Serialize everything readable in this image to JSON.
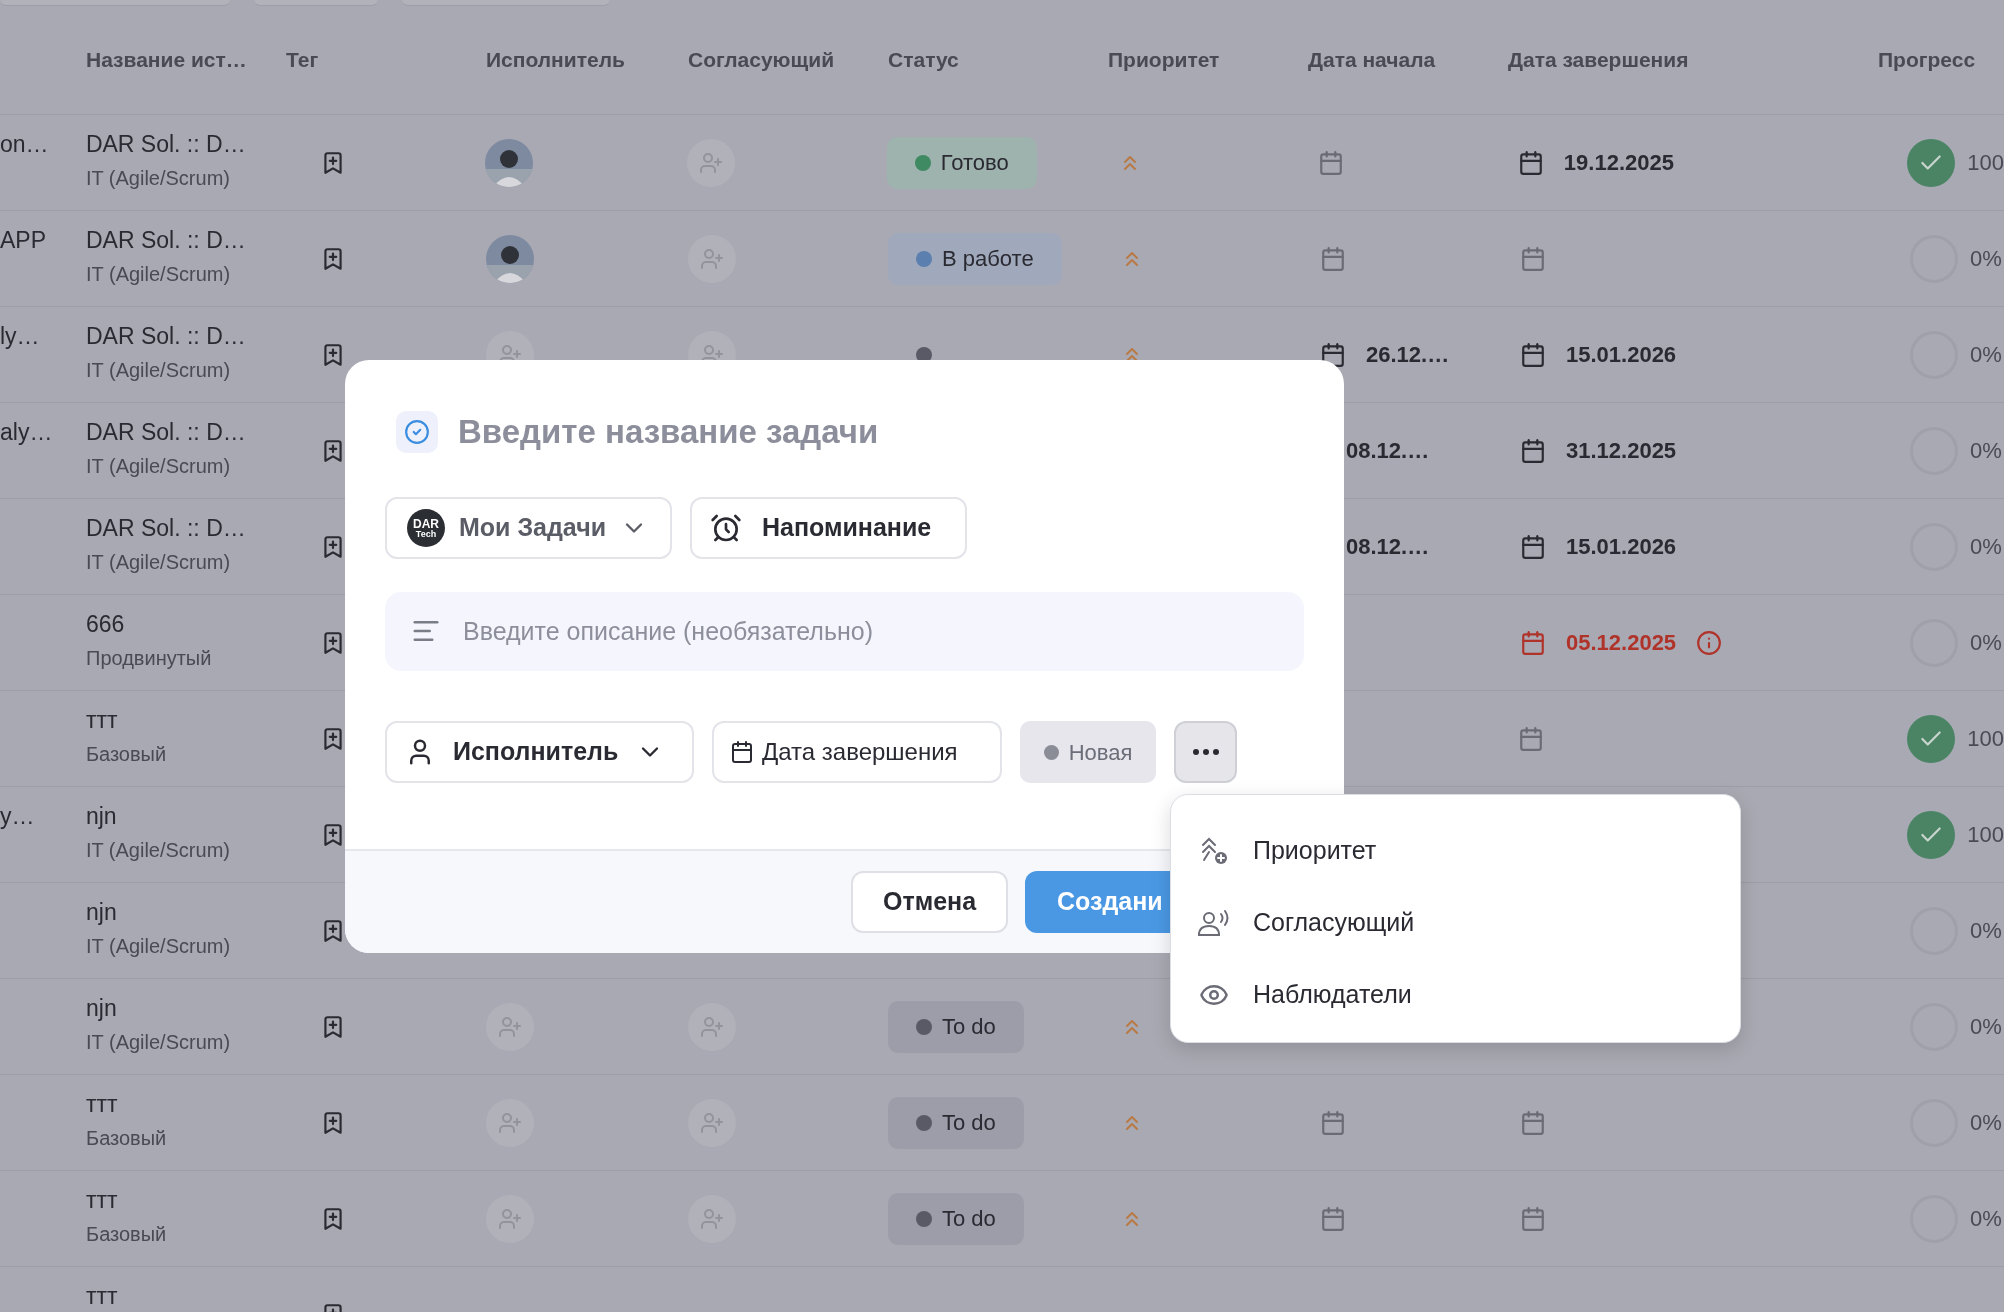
{
  "filter_chips": [
    {
      "kind": "chip"
    },
    {
      "kind": "chip"
    },
    {
      "kind": "chip"
    }
  ],
  "table": {
    "columns": [
      "Название ист…",
      "Тег",
      "Исполнитель",
      "Согласующий",
      "Статус",
      "Приоритет",
      "Дата начала",
      "Дата завершения",
      "Прогресс"
    ],
    "rows": [
      {
        "lead": "on…",
        "title": "DAR Sol. :: D…",
        "subtitle": "IT (Agile/Scrum)",
        "approver": {
          "kind": "empty"
        },
        "status": {
          "label": "Готово",
          "kind": "done",
          "color": "#3f8a63"
        },
        "priority": {
          "kind": "high"
        },
        "start": {
          "kind": "empty"
        },
        "end": {
          "kind": "filled",
          "text": "19.12.2025",
          "overdue": false
        },
        "progress": {
          "complete": true,
          "text": "100"
        }
      },
      {
        "lead": "APP",
        "title": "DAR Sol. :: D…",
        "subtitle": "IT (Agile/Scrum)",
        "approver": {
          "kind": "empty"
        },
        "status": {
          "label": "В работе",
          "kind": "progress",
          "color": "#5b7fae"
        },
        "priority": {
          "kind": "high"
        },
        "start": {
          "kind": "empty"
        },
        "end": {
          "kind": "empty"
        },
        "progress": {
          "complete": false,
          "text": "0%"
        }
      },
      {
        "lead": "ly…",
        "title": "DAR Sol. :: D…",
        "subtitle": "IT (Agile/Scrum)",
        "assignee": {
          "kind": "empty"
        },
        "approver": {
          "kind": "empty"
        },
        "status": {
          "kind": "backlog",
          "color": "#5a5a66"
        },
        "priority": {
          "kind": "high"
        },
        "start": {
          "kind": "filled",
          "text": "26.12.…"
        },
        "end": {
          "kind": "filled",
          "text": "15.01.2026",
          "overdue": false
        },
        "progress": {
          "complete": false,
          "text": "0%"
        }
      },
      {
        "lead": "aly…",
        "title": "DAR Sol. :: D…",
        "subtitle": "IT (Agile/Scrum)",
        "start": {
          "kind": "text",
          "text": "08.12.…"
        },
        "end": {
          "kind": "filled",
          "text": "31.12.2025",
          "overdue": false
        },
        "progress": {
          "complete": false,
          "text": "0%"
        }
      },
      {
        "title": "DAR Sol. :: D…",
        "subtitle": "IT (Agile/Scrum)",
        "start": {
          "kind": "text",
          "text": "08.12.…"
        },
        "end": {
          "kind": "filled",
          "text": "15.01.2026",
          "overdue": false
        },
        "progress": {
          "complete": false,
          "text": "0%"
        }
      },
      {
        "title": "666",
        "subtitle": "Продвинутый",
        "end": {
          "kind": "filled",
          "text": "05.12.2025",
          "overdue": true
        },
        "progress": {
          "complete": false,
          "text": "0%"
        }
      },
      {
        "title": "ттт",
        "subtitle": "Базовый",
        "end": {
          "kind": "empty"
        },
        "progress": {
          "complete": true,
          "text": "100"
        }
      },
      {
        "lead": "y…",
        "title": "njn",
        "subtitle": "IT (Agile/Scrum)",
        "progress": {
          "complete": true,
          "text": "100"
        }
      },
      {
        "title": "njn",
        "subtitle": "IT (Agile/Scrum)",
        "progress": {
          "complete": false,
          "text": "0%"
        }
      },
      {
        "title": "njn",
        "subtitle": "IT (Agile/Scrum)",
        "assignee": {
          "kind": "empty"
        },
        "approver": {
          "kind": "empty"
        },
        "status": {
          "label": "To do",
          "kind": "todo",
          "color": "#5a5a66"
        },
        "priority": {
          "kind": "high"
        },
        "progress": {
          "complete": false,
          "text": "0%"
        }
      },
      {
        "title": "ттт",
        "subtitle": "Базовый",
        "assignee": {
          "kind": "empty"
        },
        "approver": {
          "kind": "empty"
        },
        "status": {
          "label": "To do",
          "kind": "todo",
          "color": "#5a5a66"
        },
        "priority": {
          "kind": "high"
        },
        "start": {
          "kind": "empty"
        },
        "end": {
          "kind": "empty"
        },
        "progress": {
          "complete": false,
          "text": "0%"
        }
      },
      {
        "title": "ттт",
        "subtitle": "Базовый",
        "assignee": {
          "kind": "empty"
        },
        "approver": {
          "kind": "empty"
        },
        "status": {
          "label": "To do",
          "kind": "todo",
          "color": "#5a5a66"
        },
        "priority": {
          "kind": "high"
        },
        "start": {
          "kind": "empty"
        },
        "end": {
          "kind": "empty"
        },
        "progress": {
          "complete": false,
          "text": "0%"
        }
      },
      {
        "title": "ттт"
      }
    ]
  },
  "modal": {
    "title_placeholder": "Введите название задачи",
    "project": {
      "label": "Мои Задачи",
      "logo": "DAR",
      "logo_sub": "Tech"
    },
    "reminder": "Напоминание",
    "description_placeholder": "Введите описание (необязательно)",
    "assignee": "Исполнитель",
    "due_date": "Дата завершения",
    "status": "Новая",
    "more": {
      "expanded": true
    },
    "buttons": {
      "cancel": "Отмена",
      "create": "Создани"
    }
  },
  "menu": [
    {
      "kind": "priority",
      "label": "Приоритет"
    },
    {
      "kind": "approver",
      "label": "Согласующий"
    },
    {
      "kind": "watchers",
      "label": "Наблюдатели"
    }
  ]
}
